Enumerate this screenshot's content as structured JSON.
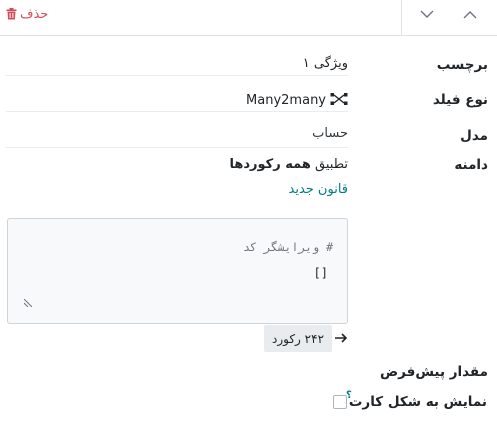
{
  "toolbar": {
    "delete_label": "حذف",
    "delete_color": "#d44c59"
  },
  "fields": {
    "label": {
      "title": "برچسب",
      "value": "ویژگی ۱"
    },
    "field_type": {
      "title": "نوع فیلد",
      "value": "Many2many",
      "icon": "many2many-icon"
    },
    "model": {
      "title": "مدل",
      "value": "حساب"
    },
    "domain": {
      "title": "دامنه",
      "prefix": "تطبیق",
      "bold": "همه رکوردها",
      "new_rule": "قانون جدید",
      "editor_comment": "# ویرایشگر کد",
      "editor_value": "[]",
      "record_count": "۲۴۲ رکورد"
    },
    "default_value": {
      "title": "مقدار پیش‌فرض"
    },
    "show_as_card": {
      "title": "نمایش به شکل کارت",
      "help": "؟",
      "checked": false
    }
  },
  "colors": {
    "link": "#017e84",
    "danger": "#d44c59"
  }
}
